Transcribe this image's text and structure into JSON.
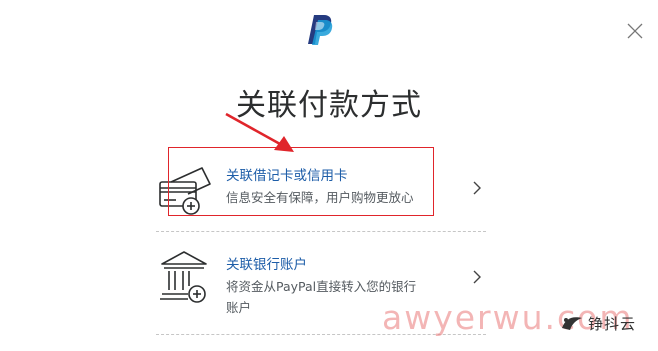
{
  "dialog": {
    "title": "关联付款方式",
    "logo_icon": "paypal-logo-icon",
    "close_icon": "close-icon"
  },
  "options": [
    {
      "label": "关联借记卡或信用卡",
      "description": "信息安全有保障，用户购物更放心",
      "icon": "credit-card-add-icon"
    },
    {
      "label": "关联银行账户",
      "description": "将资金从PayPal直接转入您的银行账户",
      "icon": "bank-add-icon"
    }
  ],
  "overlay": {
    "watermark": "awyerwu.com",
    "brand_text": "铮抖云",
    "highlight_color": "#e0252b"
  },
  "colors": {
    "link": "#1d5da8",
    "paypal_dark": "#253b80",
    "paypal_light": "#179bd7"
  }
}
